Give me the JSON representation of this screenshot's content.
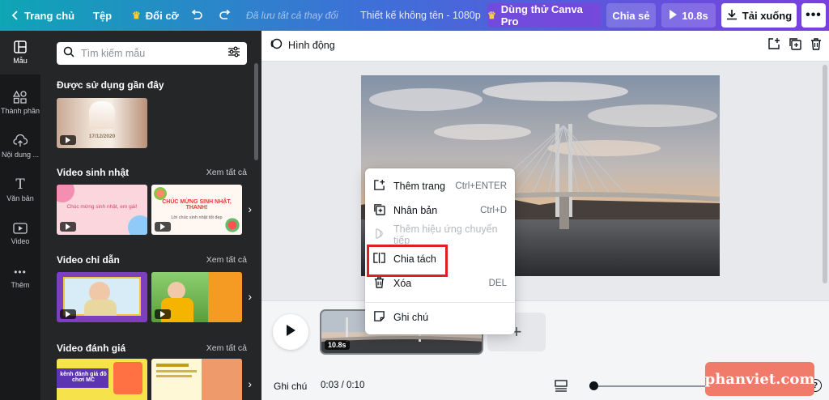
{
  "topbar": {
    "home": "Trang chủ",
    "file": "Tệp",
    "resize": "Đổi cỡ",
    "saved_status": "Đã lưu tất cả thay đổi",
    "doc_title": "Thiết kế không tên - 1080p",
    "try_pro": "Dùng thử Canva Pro",
    "share": "Chia sẻ",
    "duration": "10.8s",
    "download": "Tải xuống",
    "more_icon": "more-horizontal-icon"
  },
  "rail": [
    {
      "label": "Mẫu",
      "icon": "template-icon"
    },
    {
      "label": "Thành phần",
      "icon": "elements-icon"
    },
    {
      "label": "Nội dung ...",
      "icon": "upload-icon"
    },
    {
      "label": "Văn bản",
      "icon": "text-icon"
    },
    {
      "label": "Video",
      "icon": "video-icon"
    },
    {
      "label": "Thêm",
      "icon": "more-icon"
    }
  ],
  "panel": {
    "search_placeholder": "Tìm kiếm mẫu",
    "sections": [
      {
        "title": "Được sử dụng gần đây",
        "see_all": ""
      },
      {
        "title": "Video sinh nhật",
        "see_all": "Xem tất cả"
      },
      {
        "title": "Video chỉ dẫn",
        "see_all": "Xem tất cả"
      },
      {
        "title": "Video đánh giá",
        "see_all": "Xem tất cả"
      }
    ],
    "thumb_texts": {
      "recent_date": "17/12/2020",
      "bday1": "Chúc mừng sinh nhật, em gái!",
      "bday2": "CHÚC MỪNG SINH NHẬT, THANH!",
      "bday2_sub": "Lời chúc sinh nhật tốt đẹp",
      "review1": "kênh đánh giá đồ chơi MC"
    }
  },
  "editor": {
    "animate": "Hình động"
  },
  "context_menu": [
    {
      "label": "Thêm trang",
      "shortcut": "Ctrl+ENTER",
      "icon": "add-page-icon",
      "enabled": true
    },
    {
      "label": "Nhân bản",
      "shortcut": "Ctrl+D",
      "icon": "duplicate-icon",
      "enabled": true
    },
    {
      "label": "Thêm hiệu ứng chuyển tiếp",
      "shortcut": "",
      "icon": "transition-icon",
      "enabled": false
    },
    {
      "label": "Chia tách",
      "shortcut": "",
      "icon": "split-icon",
      "enabled": true
    },
    {
      "label": "Xóa",
      "shortcut": "DEL",
      "icon": "trash-icon",
      "enabled": true
    },
    {
      "label": "Ghi chú",
      "shortcut": "",
      "icon": "note-icon",
      "enabled": true
    }
  ],
  "timeline": {
    "clip_duration": "10.8s",
    "notes": "Ghi chú",
    "time": "0:03 / 0:10",
    "add_page": "+"
  },
  "watermark": "phanviet.com",
  "colors": {
    "accent_red": "#e02020",
    "topbar_start": "#0ea5b5",
    "topbar_end": "#7a3fe0",
    "panel_bg": "#252627"
  }
}
